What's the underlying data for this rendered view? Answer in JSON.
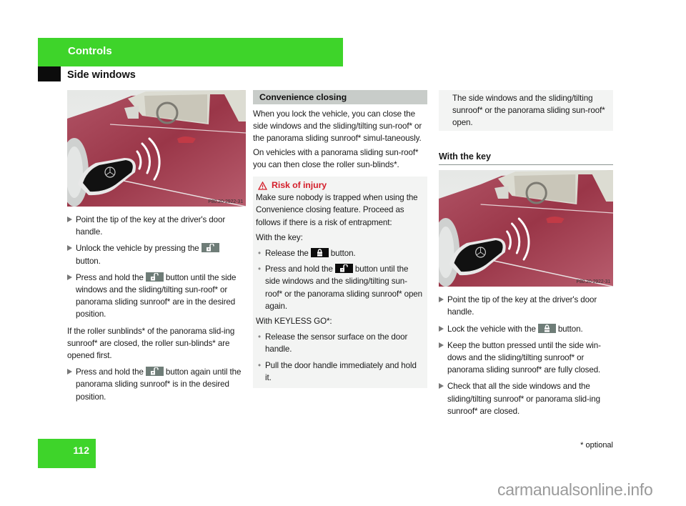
{
  "header": {
    "section": "Controls",
    "title": "Side windows",
    "accent_color": "#3ed42a"
  },
  "left_column": {
    "image": {
      "caption_code": "P80.20-2922-31",
      "alt": "key-pointed-at-drivers-door-handle"
    },
    "steps_a": [
      {
        "text": "Point the tip of the key at the driver's door handle."
      },
      {
        "before": "Unlock the vehicle by pressing the",
        "icon": "unlock-icon",
        "after": "button."
      },
      {
        "before": "Press and hold the",
        "icon": "unlock-icon",
        "after": "button until the side windows and the sliding/tilting sun-roof* or panorama sliding sunroof* are in the desired position."
      }
    ],
    "paragraph": "If the roller sunblinds* of the panorama slid-ing sunroof* are closed, the roller sun-blinds* are opened first.",
    "steps_b": [
      {
        "before": "Press and hold the",
        "icon": "unlock-icon",
        "after": "button again until the panorama sliding sunroof* is in the desired position."
      }
    ]
  },
  "middle_column": {
    "section_heading": "Convenience closing",
    "paragraphs": [
      "When you lock the vehicle, you can close the side windows and the sliding/tilting sun-roof* or the panorama sliding sunroof* simul-taneously.",
      "On vehicles with a panorama sliding sun-roof* you can then close the roller sun-blinds*."
    ],
    "warning": {
      "title": "Risk of injury",
      "color": "#d41f2b",
      "intro": "Make sure nobody is trapped when using the Convenience closing feature. Proceed as follows if there is a risk of entrapment:",
      "with_key_label": "With the key:",
      "with_key_items": [
        {
          "before": "Release the",
          "icon": "lock-icon",
          "after": "button."
        },
        {
          "before": "Press and hold the",
          "icon": "unlock-icon",
          "after": "button until the side windows and the sliding/tilting sun-roof* or the panorama sliding sunroof* open again."
        }
      ],
      "keyless_label": "With KEYLESS GO*:",
      "keyless_items": [
        {
          "text": "Release the sensor surface on the door handle."
        },
        {
          "text": "Pull the door handle immediately and hold it."
        }
      ]
    }
  },
  "right_column": {
    "note": "The side windows and the sliding/tilting sunroof* or the panorama sliding sun-roof* open.",
    "sub_heading": "With the key",
    "image": {
      "caption_code": "P80.20-2922-31",
      "alt": "key-pointed-at-drivers-door-handle"
    },
    "steps": [
      {
        "text": "Point the tip of the key at the driver's door handle."
      },
      {
        "before": "Lock the vehicle with the",
        "icon": "lock-icon",
        "after": "button."
      },
      {
        "text": "Keep the button pressed until the side win-dows and the sliding/tilting sunroof* or panorama sliding sunroof* are fully closed."
      },
      {
        "text": "Check that all the side windows and the sliding/tilting sunroof* or panorama slid-ing sunroof* are closed."
      }
    ]
  },
  "footer": {
    "page_number": "112",
    "footnote": "* optional",
    "watermark": "carmanualsonline.info"
  }
}
